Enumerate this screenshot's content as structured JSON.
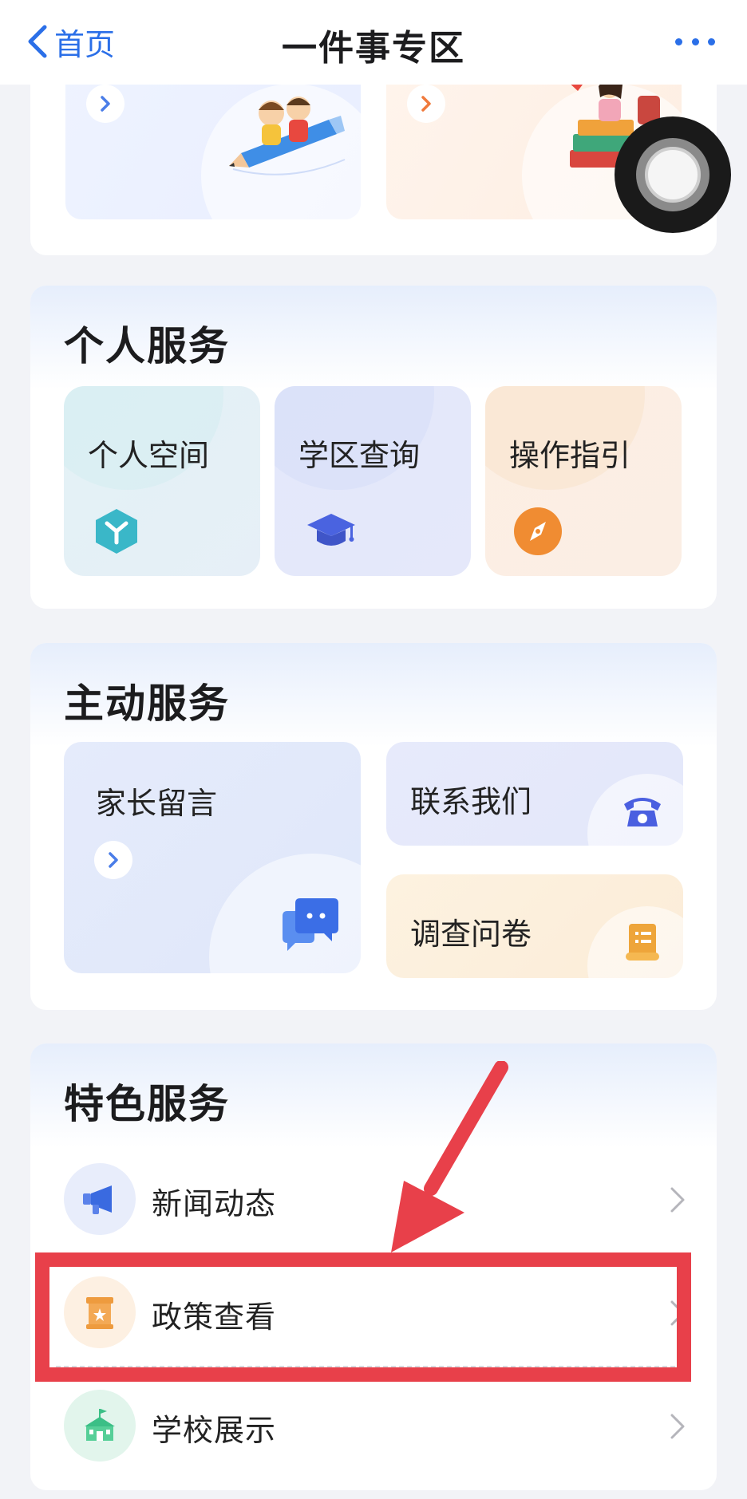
{
  "nav": {
    "back_label": "首页",
    "title": "一件事专区"
  },
  "personal": {
    "title": "个人服务",
    "items": [
      {
        "label": "个人空间",
        "icon": "cube-icon",
        "color": "#3ab7c8"
      },
      {
        "label": "学区查询",
        "icon": "graduation-cap-icon",
        "color": "#4a63e0"
      },
      {
        "label": "操作指引",
        "icon": "compass-icon",
        "color": "#f08c32"
      }
    ]
  },
  "active": {
    "title": "主动服务",
    "parent_message": "家长留言",
    "contact_us": "联系我们",
    "survey": "调查问卷"
  },
  "special": {
    "title": "特色服务",
    "items": [
      {
        "label": "新闻动态",
        "icon": "megaphone-icon"
      },
      {
        "label": "政策查看",
        "icon": "policy-scroll-icon"
      },
      {
        "label": "学校展示",
        "icon": "school-building-icon"
      }
    ]
  },
  "colors": {
    "accent_blue": "#2b6fe8",
    "highlight_red": "#e8404a"
  }
}
